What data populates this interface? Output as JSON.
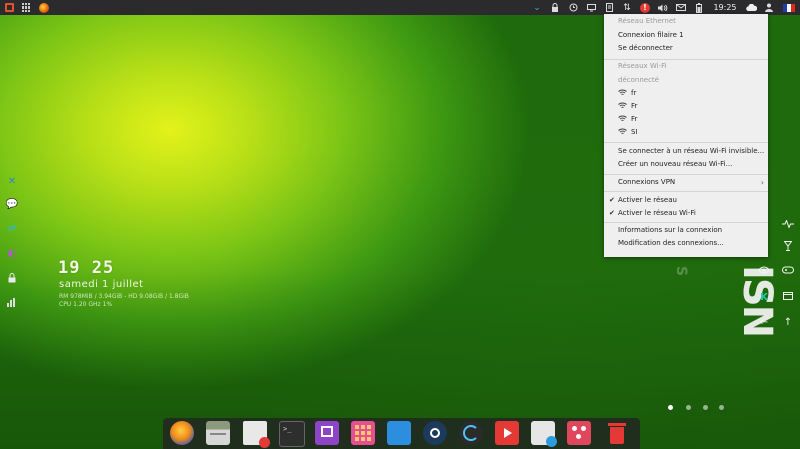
{
  "top_panel": {
    "clock": "19:25",
    "icons": [
      "app-menu-icon",
      "apps-grid-icon",
      "firefox-icon",
      "chevron-down-icon",
      "lock-icon",
      "history-icon",
      "display-icon",
      "document-icon",
      "network-icon",
      "alert-icon",
      "volume-icon",
      "mail-icon",
      "battery-icon",
      "clock",
      "cloud-icon",
      "user-icon",
      "flag-fr-icon"
    ]
  },
  "network_menu": {
    "ethernet_header": "Réseau Ethernet",
    "wired_connection": "Connexion filaire 1",
    "disconnect": "Se déconnecter",
    "wifi_header": "Réseaux Wi-Fi",
    "wifi_status": "déconnecté",
    "wifi_networks": [
      {
        "name": "fr"
      },
      {
        "name": "Fr"
      },
      {
        "name": "Fr"
      },
      {
        "name": "SI"
      }
    ],
    "connect_hidden": "Se connecter à un réseau Wi-Fi invisible...",
    "create_new": "Créer un nouveau réseau Wi-Fi...",
    "vpn": "Connexions VPN",
    "enable_network": "Activer le réseau",
    "enable_wifi": "Activer le réseau Wi-Fi",
    "connection_info": "Informations sur la connexion",
    "edit_connections": "Modification des connexions..."
  },
  "desktop_clock": {
    "time": "19 25",
    "date": "samedi 1 juillet",
    "memory": "RM 978MiB / 3.94GiB - HD 9.08GiB / 1.8GiB",
    "cpu": "CPU 1.20 GHz 1%"
  },
  "logo_text": "ISN",
  "left_widgets": [
    "close-icon",
    "chat-icon",
    "arrows-icon",
    "mask-icon",
    "lock-icon",
    "bars-chart-icon"
  ],
  "right_widgets": [
    "pulse-icon",
    "glass-icon",
    "eye-icon",
    "gamepad-icon",
    "k-icon",
    "window-icon",
    "arrow-left-icon",
    "arrow-up-icon"
  ],
  "page_dots": {
    "count": 4,
    "active": 1
  },
  "dock": {
    "apps": [
      "firefox",
      "files",
      "text-editor",
      "terminal",
      "twitch",
      "app-grid",
      "desktop",
      "steam",
      "update-manager",
      "youtube",
      "software-store",
      "sketch",
      "trash"
    ]
  },
  "colors": {
    "panel": "#2b2b2d",
    "menu_bg": "#efefef",
    "alert": "#e53935"
  }
}
